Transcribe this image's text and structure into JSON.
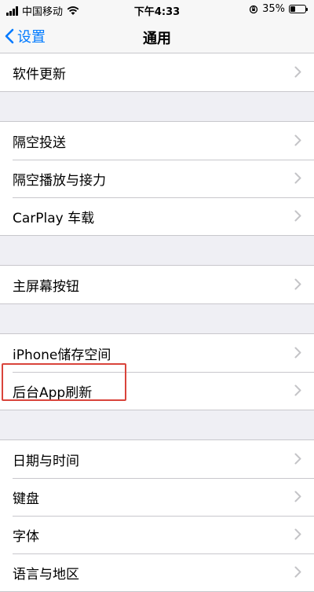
{
  "status_bar": {
    "carrier": "中国移动",
    "time": "下午4:33",
    "battery_percent": "35%",
    "battery_level": 0.35
  },
  "nav": {
    "back_label": "设置",
    "title": "通用"
  },
  "rows": {
    "software_update": "软件更新",
    "airdrop": "隔空投送",
    "airplay_handoff": "隔空播放与接力",
    "carplay": "CarPlay 车载",
    "home_button": "主屏幕按钮",
    "iphone_storage": "iPhone储存空间",
    "background_refresh": "后台App刷新",
    "date_time": "日期与时间",
    "keyboard": "键盘",
    "fonts": "字体",
    "language_region": "语言与地区"
  },
  "colors": {
    "accent": "#007aff",
    "highlight": "#d9443b"
  }
}
